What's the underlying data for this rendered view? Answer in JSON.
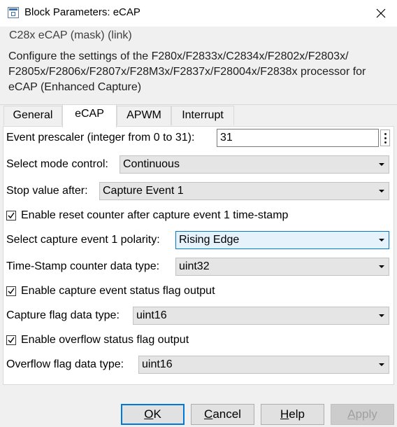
{
  "window": {
    "title": "Block Parameters: eCAP",
    "close_icon": "close-icon",
    "app_icon": "block-parameters-icon"
  },
  "description": {
    "mask_title": "C28x eCAP (mask) (link)",
    "text": "Configure the settings of the F280x/F2833x/C2834x/F2802x/F2803x/ F2805x/F2806x/F2807x/F28M3x/F2837x/F28004x/F2838x processor for eCAP (Enhanced Capture)"
  },
  "tabs": [
    "General",
    "eCAP",
    "APWM",
    "Interrupt"
  ],
  "active_tab": "eCAP",
  "params": {
    "prescaler": {
      "label": "Event prescaler (integer from 0 to 31):",
      "value": "31"
    },
    "mode": {
      "label": "Select mode control:",
      "value": "Continuous"
    },
    "stop": {
      "label": "Stop value after:",
      "value": "Capture Event 1"
    },
    "reset": {
      "label": "Enable reset counter after capture event 1 time-stamp",
      "checked": true
    },
    "polarity": {
      "label": "Select capture event 1 polarity:",
      "value": "Rising Edge"
    },
    "tsc": {
      "label": "Time-Stamp counter data type:",
      "value": "uint32"
    },
    "status_flag": {
      "label": "Enable capture event status flag output",
      "checked": true
    },
    "cap_flag_type": {
      "label": "Capture flag data type:",
      "value": "uint16"
    },
    "overflow_flag": {
      "label": "Enable overflow status flag output",
      "checked": true
    },
    "ovf_type": {
      "label": "Overflow flag data type:",
      "value": "uint16"
    }
  },
  "buttons": {
    "ok_u": "O",
    "ok_rest": "K",
    "cancel_u": "C",
    "cancel_rest": "ancel",
    "help_u": "H",
    "help_rest": "elp",
    "apply_u": "A",
    "apply_rest": "pply"
  }
}
